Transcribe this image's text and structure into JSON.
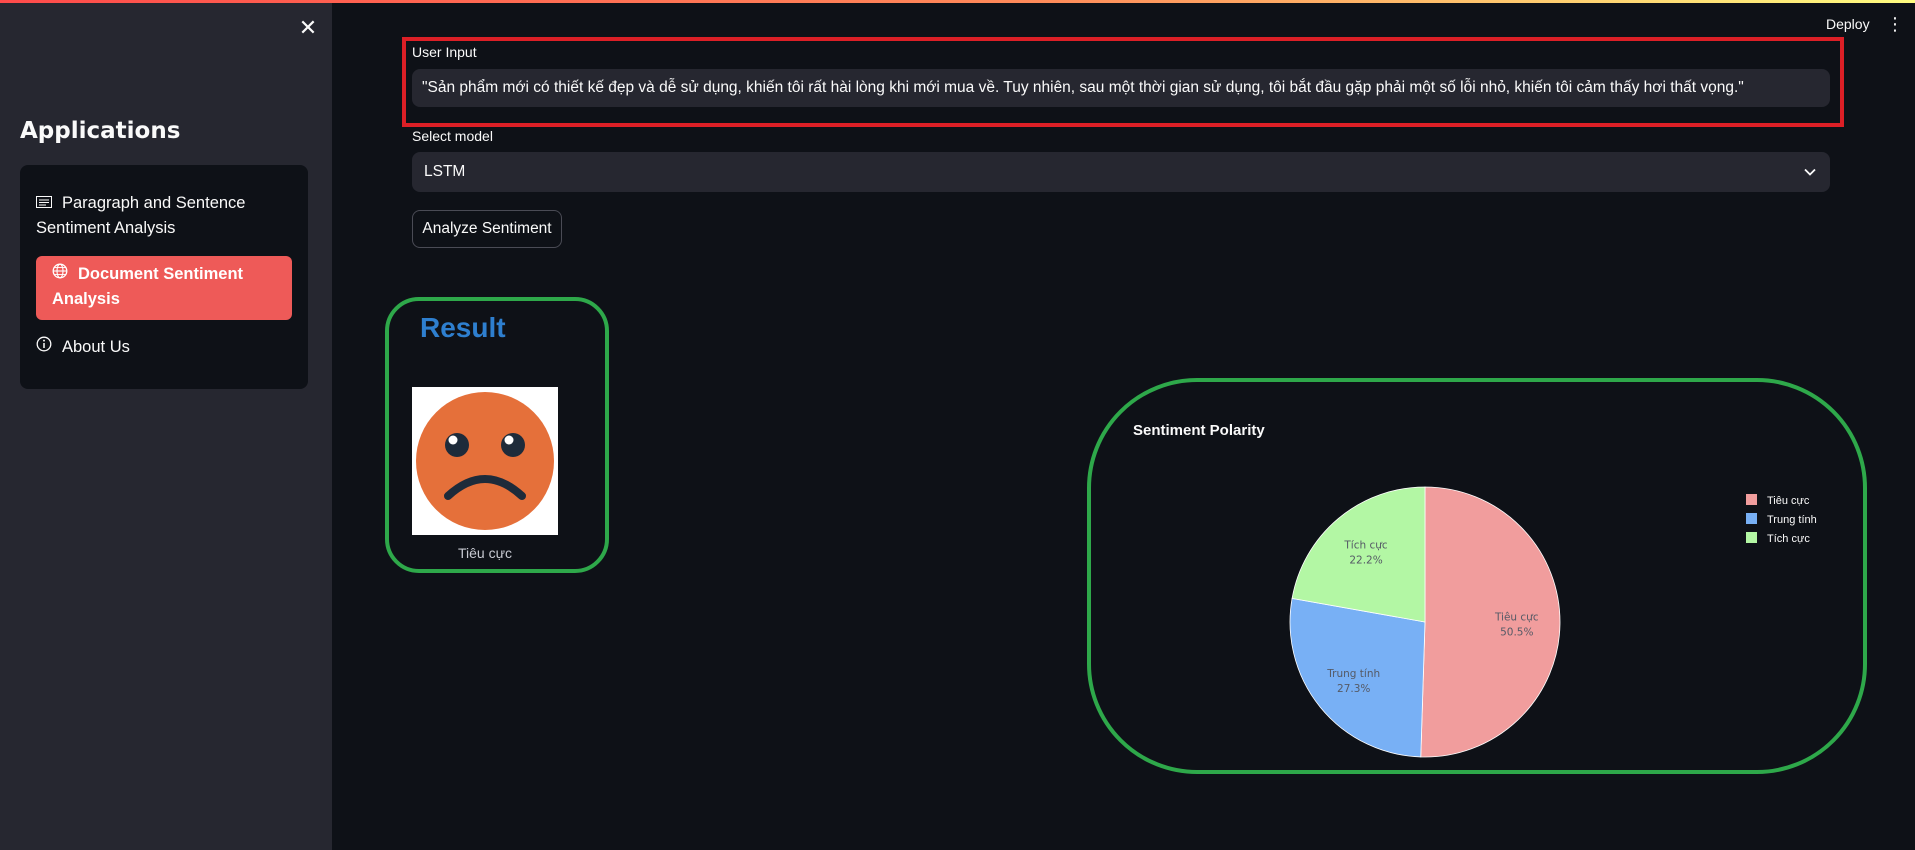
{
  "sidebar": {
    "title": "Applications",
    "items": [
      {
        "label": "Paragraph and Sentence Sentiment Analysis",
        "icon": "document-icon"
      },
      {
        "label": "Document Sentiment Analysis",
        "icon": "globe-icon",
        "active": true
      },
      {
        "label": "About Us",
        "icon": "info-icon"
      }
    ]
  },
  "header": {
    "deploy_label": "Deploy"
  },
  "main": {
    "input_label": "User Input",
    "input_value": "\"Sản phẩm mới có thiết kế đẹp và dễ sử dụng, khiến tôi rất hài lòng khi mới mua về. Tuy nhiên, sau một thời gian sử dụng, tôi bắt đầu gặp phải một số lỗi nhỏ, khiến tôi cảm thấy hơi thất vọng.\"",
    "select_label": "Select model",
    "select_value": "LSTM",
    "analyze_button": "Analyze Sentiment",
    "result_title": "Result",
    "result_caption": "Tiêu cực"
  },
  "colors": {
    "accent": "#ee5a58",
    "result_title": "#2e7fcf",
    "highlight_red": "#dc1f26",
    "highlight_green": "#2ea84a",
    "emoji_face": "#e5703a",
    "emoji_features": "#1e2b3a"
  },
  "chart_data": {
    "type": "pie",
    "title": "Sentiment Polarity",
    "labels": [
      "Tiêu cực",
      "Trung tính",
      "Tích cực"
    ],
    "values": [
      50.5,
      27.3,
      22.2
    ],
    "value_labels": [
      "50.5%",
      "27.3%",
      "22.2%"
    ],
    "colors": [
      "#f19d9d",
      "#78b0f5",
      "#b3f7a4"
    ],
    "legend": "right",
    "start_angle_deg": 90,
    "direction": "clockwise"
  }
}
